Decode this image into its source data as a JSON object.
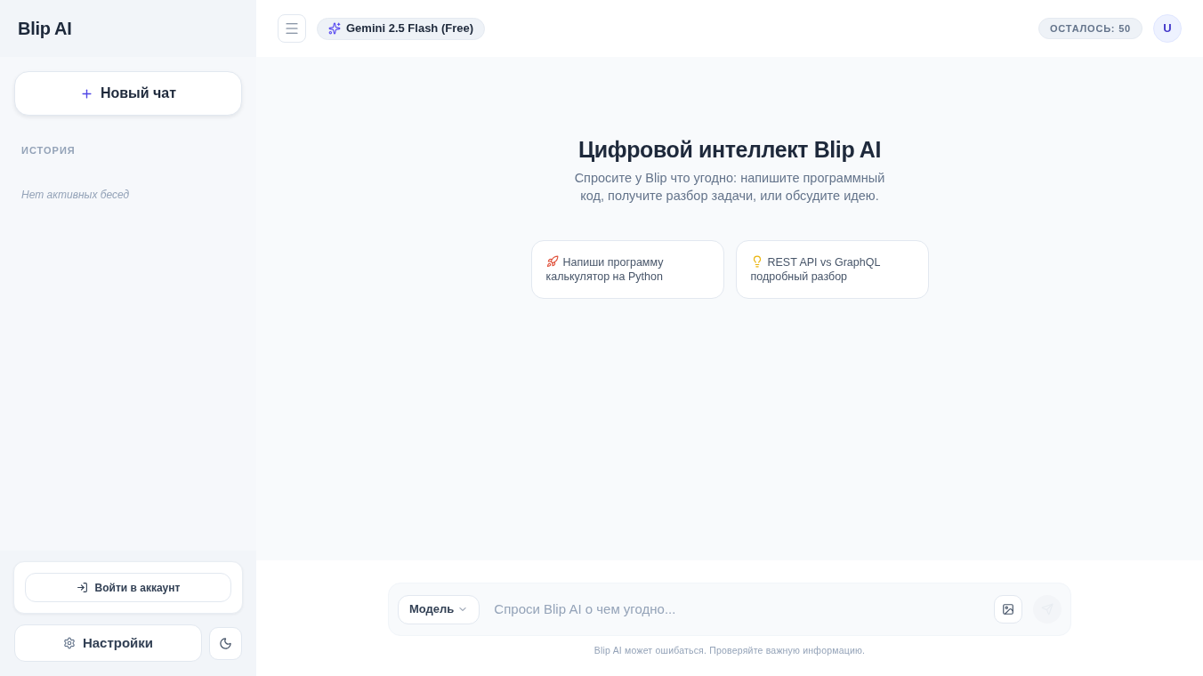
{
  "sidebar": {
    "brand": "Blip AI",
    "new_chat_button": {
      "label": "Новый чат"
    },
    "history": {
      "heading": "ИСТОРИЯ",
      "empty_text": "Нет активных бесед"
    },
    "login_button": {
      "label": "Войти в аккаунт"
    },
    "settings_button": {
      "label": "Настройки"
    }
  },
  "header": {
    "model_badge": "Gemini 2.5 Flash (Free)",
    "remaining_badge": "ОСТАЛОСЬ: 50",
    "avatar": "U"
  },
  "welcome": {
    "title": "Цифровой интеллект Blip AI",
    "subtitle": "Спросите у Blip что угодно: напишите программный код, получите разбор задачи, или обсудите идею.",
    "suggestions": [
      {
        "text": "Напиши программу калькулятор на Python"
      },
      {
        "text": "REST API vs GraphQL подробный разбор"
      }
    ]
  },
  "composer": {
    "model_select": {
      "label": "Модель"
    },
    "input": {
      "placeholder": "Спроси Blip AI о чем угодно..."
    },
    "send_button": {
      "disabled": true
    }
  },
  "disclaimer": "Blip AI может ошибаться. Проверяйте важную информацию."
}
